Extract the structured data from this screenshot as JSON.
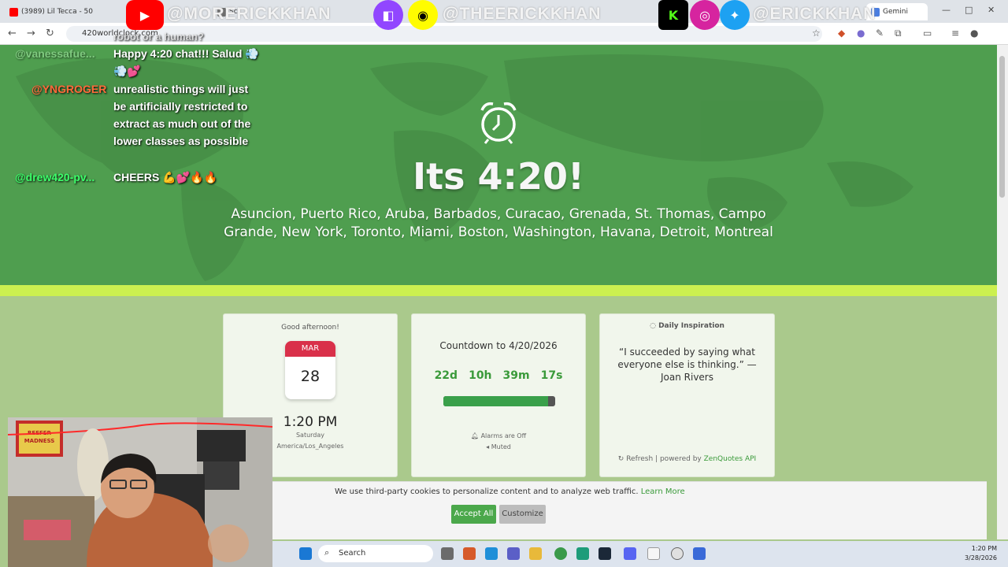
{
  "browser": {
    "tabs": [
      {
        "label": "(3989) Lil Tecca - 50",
        "fav": "#ff0000"
      },
      {
        "label": "Sc",
        "fav": "#6b6b6b"
      },
      {
        "label": "Gemini",
        "fav": "#4a7de0"
      }
    ],
    "url": "420worldclock.com",
    "nav": {
      "back": "←",
      "forward": "→",
      "reload": "↻"
    },
    "window": {
      "minimize": "—",
      "maximize": "□",
      "close": "✕"
    }
  },
  "overlay": {
    "handle1": "@MORERICKKHAN",
    "handle2": "@THEERICKKHAN",
    "handle3": "@ERICKKHAN"
  },
  "chat": [
    {
      "user": "@vanessafue...",
      "user_color": "#9fe79f",
      "text": "Happy 4:20 chat!!! Salud 💨💨💕"
    },
    {
      "user": "@YNGROGER",
      "user_color": "#ff6a3a",
      "text": "unrealistic things will just be artificially restricted to extract as much out of the lower classes as possible"
    },
    {
      "user": "@drew420-pv...",
      "user_color": "#3cff6a",
      "text": "CHEERS 💪💕🔥🔥"
    }
  ],
  "chat_top": "robot or a human?",
  "hero": {
    "title": "Its 4:20!",
    "cities": "Asuncion, Puerto Rico, Aruba, Barbados, Curacao, Grenada, St. Thomas, Campo Grande, New York, Toronto, Miami, Boston, Washington, Havana, Detroit, Montreal"
  },
  "clock_card": {
    "greeting": "Good afternoon!",
    "month": "MAR",
    "day": "28",
    "time": "1:20 PM",
    "weekday": "Saturday",
    "timezone": "America/Los_Angeles"
  },
  "countdown_card": {
    "title": "Countdown to 4/20/2026",
    "days": "22d",
    "hours": "10h",
    "minutes": "39m",
    "seconds": "17s",
    "progress": 0.94,
    "alarms": "Alarms are Off",
    "muted": "Muted"
  },
  "inspiration_card": {
    "title": "Daily Inspiration",
    "quote": "“I succeeded by saying what everyone else is thinking.” — Joan Rivers",
    "refresh": "Refresh",
    "powered": "| powered by",
    "powered_link": "ZenQuotes API"
  },
  "cookie": {
    "text": "We use third-party cookies to personalize content and to analyze web traffic.",
    "link": "Learn More",
    "accept": "Accept All",
    "customize": "Customize"
  },
  "taskbar": {
    "search": "Search",
    "time": "1:20 PM",
    "date": "3/28/2026"
  },
  "webcam": {
    "poster_text": "REEFER MADNESS"
  }
}
